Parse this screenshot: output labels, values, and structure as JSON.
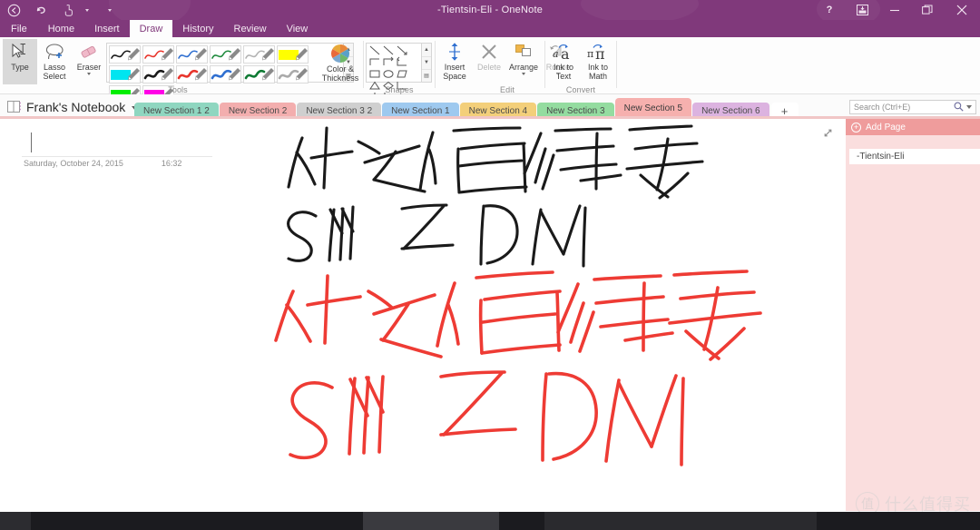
{
  "window": {
    "title": "-Tientsin-Eli - OneNote",
    "accent_color": "#80397b",
    "quick_access": [
      {
        "name": "back",
        "label": "←"
      },
      {
        "name": "undo",
        "label": "↶"
      },
      {
        "name": "touch-mode",
        "label": "touch"
      }
    ],
    "controls": [
      {
        "name": "help",
        "label": "?"
      },
      {
        "name": "ribbon-display-options",
        "label": "⬜"
      },
      {
        "name": "minimize",
        "label": "—"
      },
      {
        "name": "restore",
        "label": "❐"
      },
      {
        "name": "close",
        "label": "✕"
      }
    ]
  },
  "ribbon": {
    "tabs": [
      {
        "label": "File",
        "active": false
      },
      {
        "label": "Home",
        "active": false
      },
      {
        "label": "Insert",
        "active": false
      },
      {
        "label": "Draw",
        "active": true
      },
      {
        "label": "History",
        "active": false
      },
      {
        "label": "Review",
        "active": false
      },
      {
        "label": "View",
        "active": false
      }
    ],
    "groups": [
      {
        "label": "Tools"
      },
      {
        "label": "Shapes"
      },
      {
        "label": "Edit"
      },
      {
        "label": "Convert"
      }
    ],
    "tools": {
      "type": {
        "line1": "Type",
        "line2": ""
      },
      "lasso": {
        "line1": "Lasso",
        "line2": "Select"
      },
      "eraser": {
        "line1": "Eraser",
        "line2": ""
      },
      "color_thickness": {
        "line1": "Color &",
        "line2": "Thickness"
      }
    },
    "pens": [
      {
        "name": "pen-black",
        "color": "#1a1a1a",
        "kind": "pen"
      },
      {
        "name": "pen-red",
        "color": "#e8352c",
        "kind": "pen"
      },
      {
        "name": "pen-blue",
        "color": "#2f6fd0",
        "kind": "pen"
      },
      {
        "name": "pen-green",
        "color": "#1f8a3d",
        "kind": "pen"
      },
      {
        "name": "pen-gray",
        "color": "#b3b3b3",
        "kind": "pen"
      },
      {
        "name": "highlighter-yellow",
        "color": "#ffff00",
        "kind": "highlighter"
      },
      {
        "name": "highlighter-cyan",
        "color": "#00e5f0",
        "kind": "highlighter"
      },
      {
        "name": "pen-black-thick",
        "color": "#1a1a1a",
        "kind": "pen"
      },
      {
        "name": "pen-red-thick",
        "color": "#e8352c",
        "kind": "pen"
      },
      {
        "name": "pen-blue-thick",
        "color": "#2f6fd0",
        "kind": "pen"
      },
      {
        "name": "pen-green-thick",
        "color": "#0e7a33",
        "kind": "pen"
      },
      {
        "name": "pen-gray-thick",
        "color": "#aaaaaa",
        "kind": "pen"
      },
      {
        "name": "highlighter-green",
        "color": "#00ee00",
        "kind": "highlighter"
      },
      {
        "name": "highlighter-magenta",
        "color": "#ff00e6",
        "kind": "highlighter"
      }
    ],
    "edit": {
      "insert_space": {
        "line1": "Insert",
        "line2": "Space"
      },
      "delete": {
        "line1": "Delete",
        "line2": ""
      },
      "arrange": {
        "line1": "Arrange",
        "line2": ""
      },
      "rotate": {
        "line1": "Rotate",
        "line2": ""
      }
    },
    "convert": {
      "ink_to_text": {
        "line1": "Ink to",
        "line2": "Text"
      },
      "ink_to_math": {
        "line1": "Ink to",
        "line2": "Math"
      }
    }
  },
  "notebook": {
    "name": "Frank's Notebook",
    "sections": [
      {
        "label": "New Section 1 2",
        "color": "#8fd6c0",
        "active": false
      },
      {
        "label": "New Section 2",
        "color": "#f3aeae",
        "active": false
      },
      {
        "label": "New Section 3 2",
        "color": "#cfcfcf",
        "active": false
      },
      {
        "label": "New Section 1",
        "color": "#9ec9ef",
        "active": false
      },
      {
        "label": "New Section 4",
        "color": "#f3cf7a",
        "active": false
      },
      {
        "label": "New Section 3",
        "color": "#94dca0",
        "active": false
      },
      {
        "label": "New Section 5",
        "color": "#f6b0ae",
        "active": true
      },
      {
        "label": "New Section 6",
        "color": "#dcb3e0",
        "active": false
      }
    ],
    "add_section_label": "+"
  },
  "search": {
    "placeholder": "Search (Ctrl+E)",
    "icon": "search-icon"
  },
  "page": {
    "title_value": "",
    "date": "Saturday, October 24, 2015",
    "time": "16:32",
    "ink_notes": [
      {
        "name": "ink-black-chinese",
        "text": "什么值得买",
        "color": "#1a1a1a"
      },
      {
        "name": "ink-black-latin",
        "text": "SM2DM",
        "color": "#1a1a1a"
      },
      {
        "name": "ink-red-chinese",
        "text": "什么值得买",
        "color": "#ee3b34"
      },
      {
        "name": "ink-red-latin",
        "text": "SM2DM",
        "color": "#ee3b34"
      }
    ]
  },
  "page_pane": {
    "add_page_label": "Add Page",
    "pages": [
      {
        "label": "-Tientsin-Eli",
        "selected": true
      }
    ]
  },
  "watermark": {
    "badge": "值",
    "text": "什么值得买"
  }
}
